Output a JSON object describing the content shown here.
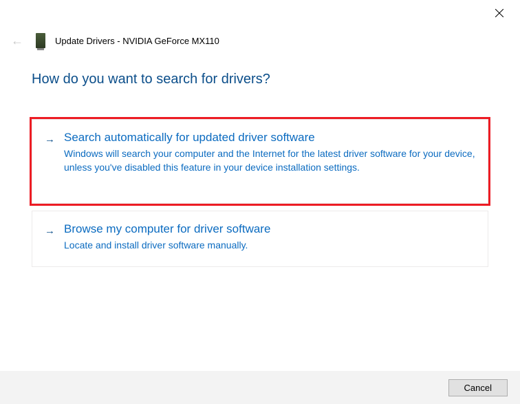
{
  "header": {
    "title": "Update Drivers - NVIDIA GeForce MX110"
  },
  "main": {
    "heading": "How do you want to search for drivers?"
  },
  "options": [
    {
      "title": "Search automatically for updated driver software",
      "description": "Windows will search your computer and the Internet for the latest driver software for your device, unless you've disabled this feature in your device installation settings."
    },
    {
      "title": "Browse my computer for driver software",
      "description": "Locate and install driver software manually."
    }
  ],
  "footer": {
    "cancel_label": "Cancel"
  }
}
